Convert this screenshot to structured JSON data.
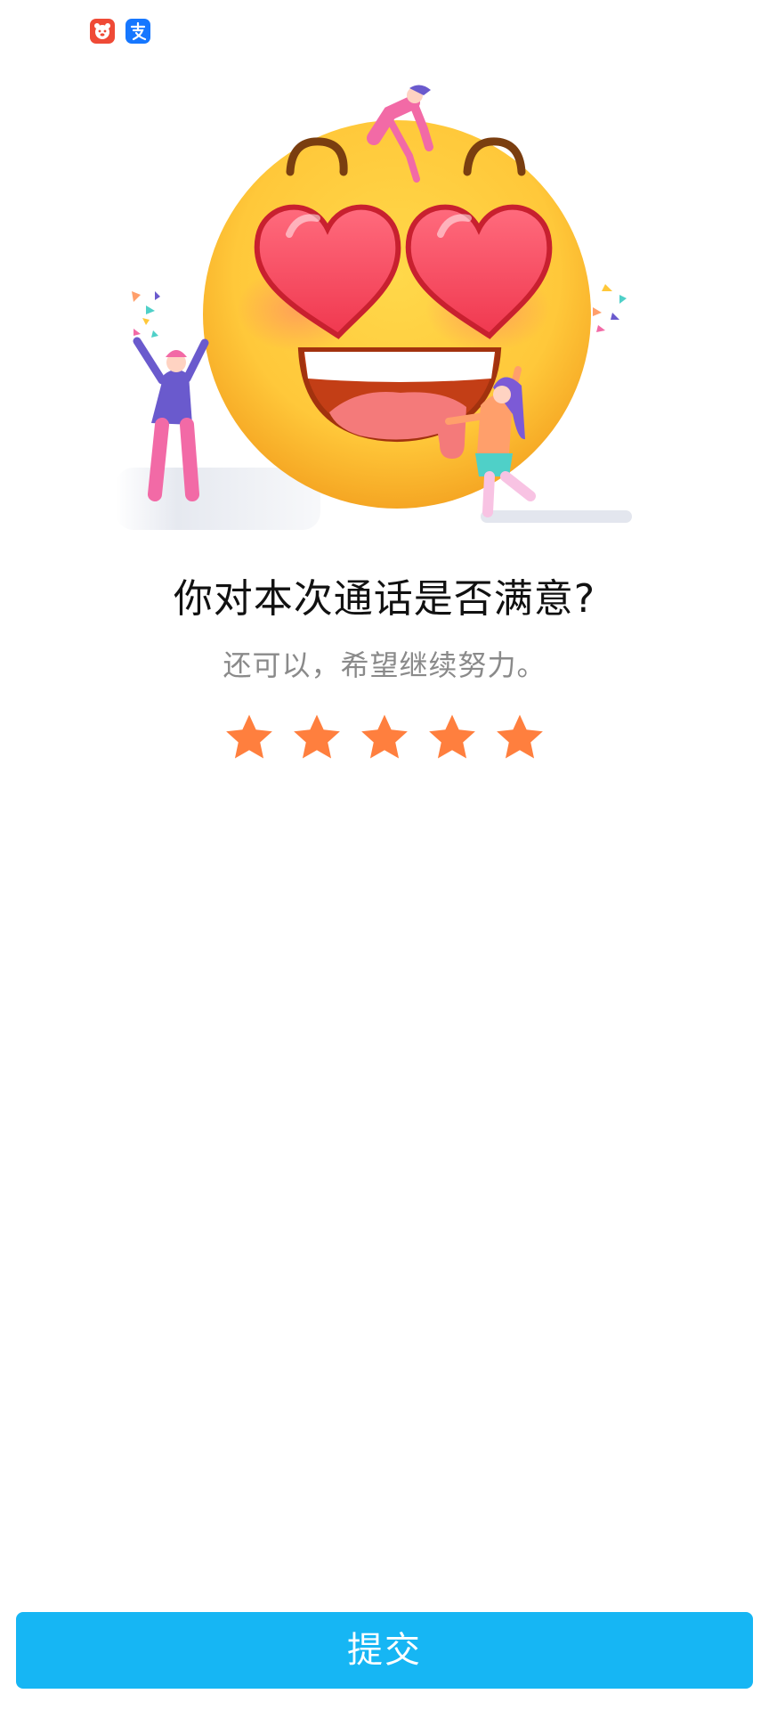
{
  "status_bar": {
    "icons": [
      "app-notification-icon",
      "alipay-notification-icon"
    ]
  },
  "rating": {
    "question": "你对本次通话是否满意?",
    "feedback": "还可以，希望继续努力。",
    "stars_total": 5,
    "stars_selected": 5,
    "star_color": "#ff7f3e"
  },
  "submit": {
    "label": "提交",
    "color": "#16b6f4"
  }
}
